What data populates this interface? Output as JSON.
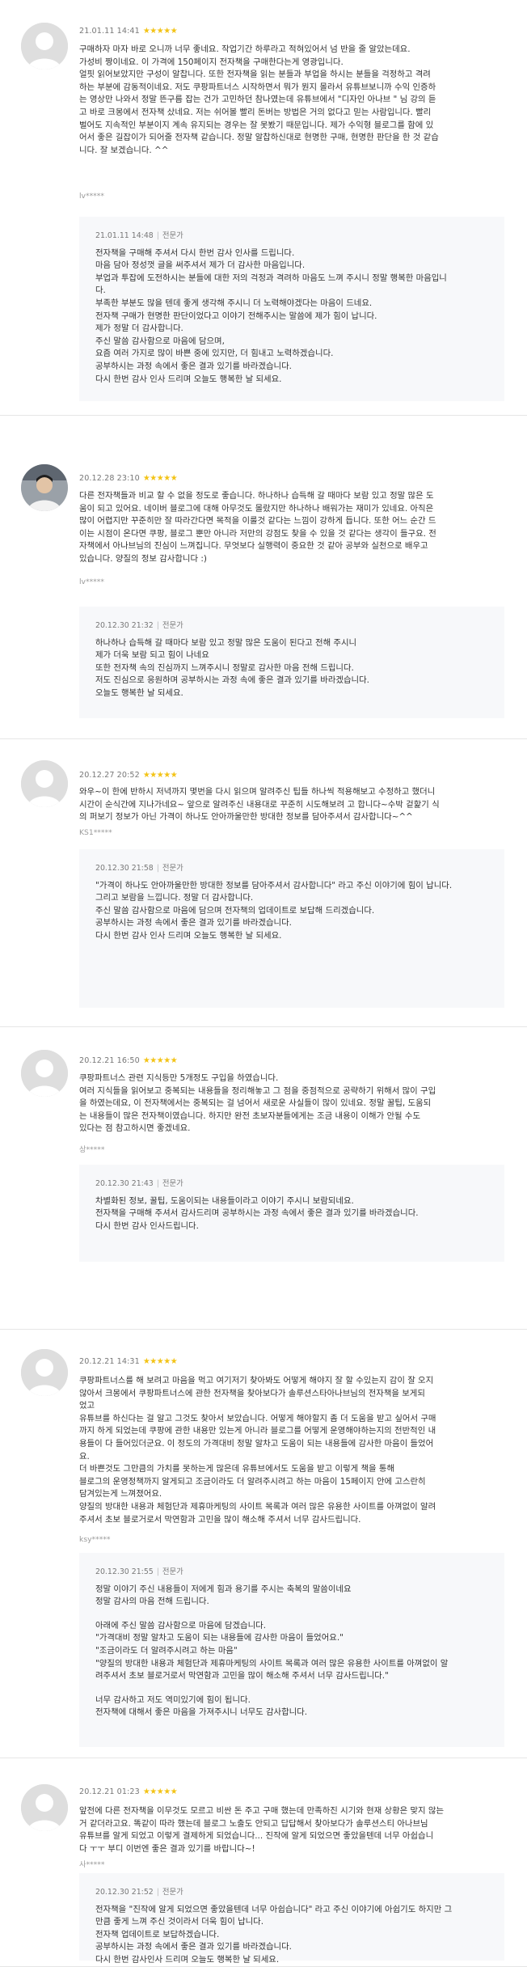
{
  "reviews": [
    {
      "date": "21.01.11 14:41",
      "stars": "★★★★★",
      "avatar": "default",
      "lines": [
        "구매하자 마자 바로 오니까 너무 좋네요. 작업기간 하루라고 적혀있어서 넘 반을 줄 알았는데요.",
        "가성비 짱이네요. 이 가격에 150페이지 전자책을 구매한다는게 영광입니다.",
        "얼핏 읽어보았지만 구성이 알찹니다. 또한 전자책을 읽는 분들과 부업을 하시는 분들을 걱정하고 격려",
        "하는 부분에 감동적이네요. 저도 쿠팡파트너스 시작하면서 뭐가 뭔지 몰라서 유튜브보니까 수익 인증하",
        "는 영상만 나와서 정말 뜬구름 잡는 건가 고민하던 참나였는데 유튜브에서 \"디자인 아나브 \" 님 강의 듣",
        "고 바로 크몽에서 전자책 샀네요. 저는 쉬어볼 빨리 돈버는 방법은 거의 없다고 믿는 사람입니다. 빨리",
        "벌어도 지속적인 부분이지 계속 유지되는 경우는 잘 못봤기 때문입니다. 제가 수익형 블로그를 함에 있",
        "어서 좋은 길잡이가 되어줄 전자책 같습니다. 정말 알찹하신대로 현명한 구매, 현명한 판단을 한 것 같습",
        "니다. 잘 보겠습니다. ^^"
      ],
      "user": "lv*****",
      "reply": {
        "date": "21.01.11 14:48",
        "role": "전문가",
        "lines": [
          "전자책을 구매해 주셔서 다시 한번 감사 인사를 드립니다.",
          "마음 담아 정성껏 글을 써주셔서 제가 더 감사한 마음입니다.",
          "부업과 투잡에 도전하시는 분들에 대한 저의 걱정과 격려하 마음도 느껴 주시니 정말 행복한 마음입니",
          "다.",
          "부족한 부분도 많을 텐데 좋게 생각해 주시니 더 노력해야겠다는 마음이 드네요.",
          "전자책 구매가 현명한 판단이었다고 이야기 전해주시는 말씀에 제가 힘이 납니다.",
          "제가 정말 더 감사합니다.",
          "주신 말씀 감사함으로 마음에 담으며,",
          "요즘 여러 가지로 많이 바쁜 중에 있지만, 더 힘내고 노력하겠습니다.",
          "공부하시는 과정 속에서 좋은 결과 있기를 바라겠습니다.",
          "다시 한번 감사 인사 드리며 오늘도 행복한 날 되세요."
        ]
      }
    },
    {
      "date": "20.12.28 23:10",
      "stars": "★★★★★",
      "avatar": "photo",
      "lines": [
        "다른 전자책들과 비교 할 수 없을 정도로 좋습니다. 하나하나 습득해 갈 때마다 보람 있고 정말 많은 도",
        "움이 되고 있어요. 네이버 블로그에 대해 아무것도 몰랐지만 하나하나 배워가는 재미가 있네요. 아직은",
        "많이 어렵지만 꾸준히만 잘 따라간다면 목적을 이룰것 같다는 느낌이 강하게 듭니다. 또한 어느 순간 드",
        "이는 시점이 온다면 쿠팡, 블로그 뿐만 아니라 저만의 강점도 찾을 수 있을 것 같다는 생각이 들구요. 전",
        "자책에서 아나브님의 진심이 느껴집니다. 무엇보다 실행력이 중요한 것 같아 공부와 실천으로 배우고",
        "있습니다. 양질의 정보 감사합니다 :)"
      ],
      "user": "lv*****",
      "reply": {
        "date": "20.12.30 21:32",
        "role": "전문가",
        "lines": [
          "하나하나 습득해 갈 때마다 보람 있고 정말 많은 도움이 된다고 전해 주시니",
          "제가 더욱 보람 되고 힘이 나네요",
          "또한 전자책 속의 진심까지 느껴주시니 정말로 감사한 마음 전해 드립니다.",
          "저도 진심으로 응원하며 공부하시는 과정 속에 좋은 결과 있기를 바라겠습니다.",
          "오늘도 행복한 날 되세요."
        ]
      }
    },
    {
      "date": "20.12.27 20:52",
      "stars": "★★★★★",
      "avatar": "default",
      "lines": [
        "와우~이 한에 반하시 저녁까지 몇번을 다시 읽으며 알려주신 팁들 하나씩 적용해보고 수정하고 했더니",
        "시간이 순식간에 지나가네요~ 앞으로 알려주신 내용대로 꾸준히 시도해보려 고 합니다~수박 겉핥기 식",
        "의 퍼보기 정보가 아닌 가격이 하나도 안아까울만한 방대한 정보를 담아주셔서 감사합니다~^^"
      ],
      "user": "KS1*****",
      "reply": {
        "date": "20.12.30 21:58",
        "role": "전문가",
        "lines": [
          "\"가격이 하나도 안아까울만한 방대한 정보를 담아주셔서 감사합니다\" 라고 주신 이야기에 힘이 납니다.",
          "그리고 보람을 느낍니다. 정말 더 감사합니다.",
          "주신 말씀 감사함으로 마음에 담으며 전자책의 업데이트로 보답해 드리겠습니다.",
          "공부하시는 과정 속에서 좋은 결과 있기를 바라겠습니다.",
          "다시 한번 감사 인사 드리며 오늘도 행복한 날 되세요."
        ]
      }
    },
    {
      "date": "20.12.21 16:50",
      "stars": "★★★★★",
      "avatar": "default",
      "lines": [
        "쿠팡파트너스 관련 지식등만 5개정도 구입을 하였습니다.",
        "여러 지식들을 읽어보고 중복되는 내용들을 정리해놓고 그 점을 중점적으로 공략하기 위해서 많이 구입",
        "을 하였는데요, 이 전자책에서는 중복되는 걸 넘어서 새로운 사실들이 많이 있네요. 정말 꿀팁, 도움되",
        "는 내용들이 많은 전자책이였습니다. 하지만 완전 초보자분들에게는 조금 내용이 이해가 안될 수도",
        "있다는 점 참고하시면 좋겠네요."
      ],
      "user": "상*****",
      "reply": {
        "date": "20.12.30 21:43",
        "role": "전문가",
        "lines": [
          "차별화된 정보, 꿀팁, 도움이되는 내용들이라고 이야기 주시니 보람되네요.",
          "전자책을 구매해 주셔서 감사드리며 공부하시는 과정 속에서 좋은 결과 있기를 바라겠습니다.",
          "다시 한번 감사 인사드립니다."
        ]
      }
    },
    {
      "date": "20.12.21 14:31",
      "stars": "★★★★★",
      "avatar": "default",
      "lines": [
        "쿠팡파트너스를 해 보려고 마음을 먹고 여기저기 찾아봐도 어떻게 해야지 잘 할 수있는지 감이 잘 오지",
        "않아서 크몽에서 쿠팡파트너스에 관한 전자책을 찾아보다가 솔루션스타아나브님의 전자책을 보게되",
        "었고",
        "유튜브를 하신다는 걸 알고 그것도 찾아서 보았습니다. 어떻게 해야할지 좀 더 도움을 받고 싶어서 구매",
        "까지 하게 되었는데 쿠팡에 관한 내용만 있는게 아니라 블로그를 어떻게 운영해야하는지의 전반적인 내",
        "용들이 다 들어있더군요. 이 정도의 가격대비 정말 알차고 도움이 되는 내용들에 감사한 마음이 들었어",
        "요.",
        "더 바쁜것도 그만큼의 가치를 못하는게 많은데 유튜브에서도 도움을 받고 이렇게 책을 통해",
        "블로그의 운영정책까지 알게되고 조금이라도 더 알려주시려고 하는 마음이 15페이지 안에 고스란히",
        "담겨있는게 느껴졌어요.",
        "양질의 방대한 내용과 체험단과 제휴마케팅의 사이트 목록과 여러 많은 유용한 사이트를 아껴없이 알려",
        "주셔서 초보 블로거로서 막연함과 고민을 많이 해소해 주셔서 너무 감사드립니다."
      ],
      "user": "ksy*****",
      "reply": {
        "date": "20.12.30 21:55",
        "role": "전문가",
        "lines": [
          "정말 이야기 주신 내용들이 저에게 힘과 용기를 주시는 축복의 말씀이네요",
          "정말 감사의 마음 전해 드립니다.",
          "",
          "아래에 주신 말씀 감사함으로 마음에 담겠습니다.",
          "\"가격대비 정말 알차고 도움이 되는 내용들에 감사한 마음이 들었어요.\"",
          "\"조금이라도 더 알려주시려고 하는 마음\"",
          "\"양질의 방대한 내용과 체험단과 제휴마케팅의 사이트 목록과 여러 많은 유용한 사이트를 아껴없이 알",
          "려주셔서 초보 블로거로서 막연함과 고민을 많이 해소해 주셔서 너무 감사드립니다.\"",
          "",
          "너무 감사하고 저도 역미있기에 힘이 됩니다.",
          "전자책에 대해서 좋은 마음을 가져주시니 너무도 감사합니다."
        ]
      }
    },
    {
      "date": "20.12.21 01:23",
      "stars": "★★★★★",
      "avatar": "default",
      "lines": [
        "앞전에 다른 전자책을 이무것도 모르고 비싼 돈 주고 구매 했는데 만족하진 시기와 현재 상황은 맞지 않는",
        "거 같더라고요. 똑같이 따라 했는데 블로그 노출도 안되고 답답해서 찾아보다가 솔루션스티 아나브님",
        "유튜브를 알게 되었고 이렇게 결제하게 되었습니다... 진작에 알게 되었으면 좋았을텐데 너무 아쉽습니",
        "다 ㅜㅜ 부디 이번엔 좋은 결과 있기를 바랍니다~!"
      ],
      "user": "사*****",
      "reply": {
        "date": "20.12.30 21:52",
        "role": "전문가",
        "lines": [
          "전자책을 \"진작에 알게 되었으면 좋았을텐데 너무 아쉽습니다\" 라고 주신 이야기에 아쉽기도 하지만 그",
          "만큼 좋게 느껴 주신 것이라서 더욱 힘이 납니다.",
          "전자책 업데이트로 보답하겠습니다.",
          "공부하시는 과정 속에서 좋은 결과 있기를 바라겠습니다.",
          "다시 한번 감사인사 드리며 오늘도 행복한 날 되세요."
        ]
      }
    }
  ]
}
